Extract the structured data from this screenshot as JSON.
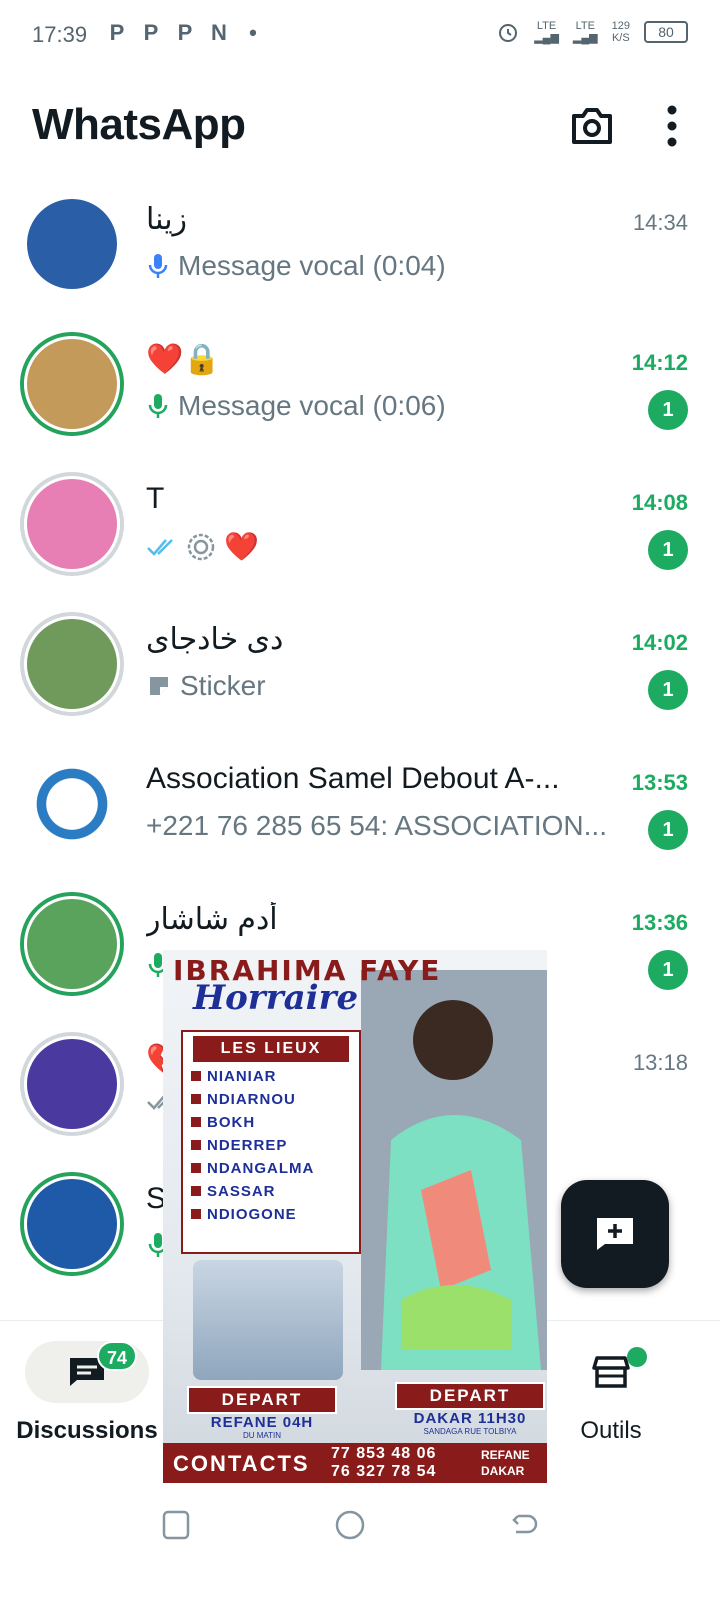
{
  "status_bar": {
    "time": "17:39",
    "app_icons": [
      "P",
      "P",
      "P",
      "N",
      "•"
    ],
    "net1": "LTE",
    "net2": "LTE",
    "speed_value": "129",
    "speed_unit": "K/S",
    "battery": "80"
  },
  "header": {
    "title": "WhatsApp",
    "camera_icon": "camera-icon",
    "menu_icon": "more-vert-icon"
  },
  "chats": [
    {
      "name": "زينا",
      "preview": "Message vocal (0:04)",
      "time": "14:34",
      "unread": "",
      "avatar_color": "#2a5fa8"
    },
    {
      "name": "❤️🔒",
      "preview": "Message vocal (0:06)",
      "time": "14:12",
      "unread": "1",
      "avatar_color": "#c49a5a"
    },
    {
      "name": "T",
      "preview": "❤️",
      "time": "14:08",
      "unread": "1",
      "avatar_color": "#e77fb5"
    },
    {
      "name": "دى خادجاى",
      "preview": "Sticker",
      "time": "14:02",
      "unread": "1",
      "avatar_color": "#6f9a5b"
    },
    {
      "name": "Association Samel Debout  A-...",
      "preview": "+221 76 285 65 54: ASSOCIATION...",
      "time": "13:53",
      "unread": "1",
      "avatar_color": "#2c7cc4"
    },
    {
      "name": "أدم شاشار",
      "preview": "",
      "time": "13:36",
      "unread": "1",
      "avatar_color": "#5aa35c"
    },
    {
      "name": "💔",
      "preview": "",
      "time": "13:18",
      "unread": "",
      "avatar_color": "#4a3aa0"
    },
    {
      "name": "Se",
      "preview": "",
      "time": "",
      "unread": "",
      "avatar_color": "#1e5aa8"
    }
  ],
  "poster": {
    "name": "IBRAHIMA FAYE",
    "subtitle": "Horraire",
    "places_title": "LES LIEUX",
    "places": [
      "NIANIAR",
      "NDIARNOU",
      "BOKH",
      "NDERREP",
      "NDANGALMA",
      "SASSAR",
      "NDIOGONE"
    ],
    "depart_left_tag": "DEPART",
    "depart_left_time": "REFANE 04H",
    "depart_left_sub": "DU MATIN",
    "depart_right_tag": "DEPART",
    "depart_right_time": "DAKAR 11H30",
    "depart_right_sub": "SANDAGA RUE TOLBIYA",
    "contacts_label": "CONTACTS",
    "contacts_num1": "77 853 48 06",
    "contacts_num2": "76 327 78 54",
    "contacts_dest1": "REFANE",
    "contacts_dest2": "DAKAR"
  },
  "fab": {
    "icon": "new-chat-icon"
  },
  "bottom_nav": {
    "discussions_label": "Discussions",
    "discussions_badge": "74",
    "tools_label": "Outils"
  }
}
